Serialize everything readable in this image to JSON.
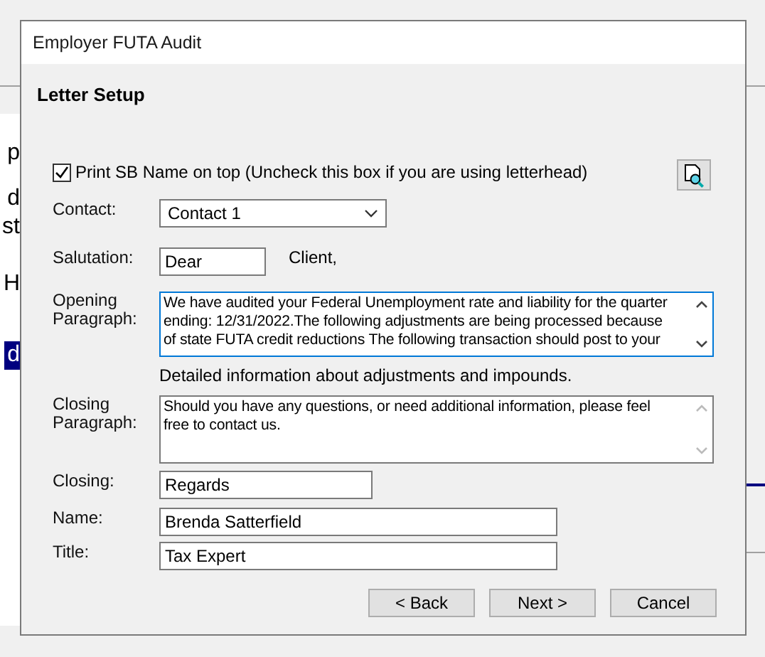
{
  "background": {
    "fragments": [
      {
        "text": "p",
        "selected": false
      },
      {
        "text": "d",
        "selected": false
      },
      {
        "text": "st",
        "selected": false
      },
      {
        "text": "H",
        "selected": false
      },
      {
        "text": "d",
        "selected": true
      }
    ]
  },
  "window": {
    "title": "Employer FUTA Audit"
  },
  "heading": "Letter Setup",
  "print_name": {
    "label": "Print SB Name on top (Uncheck this box if you are using letterhead)",
    "checked": true
  },
  "contact": {
    "label": "Contact:",
    "value": "Contact 1"
  },
  "salutation": {
    "label": "Salutation:",
    "value": "Dear",
    "suffix": "Client,"
  },
  "opening_paragraph": {
    "label": "Opening Paragraph:",
    "focused": true,
    "lines": [
      "We have audited your Federal Unemployment rate and liability for the quarter",
      "ending: 12/31/2022.The following adjustments are being processed because",
      "of state FUTA credit reductions  The following transaction should post to your"
    ]
  },
  "info_text": "Detailed information about adjustments and impounds.",
  "closing_paragraph": {
    "label": "Closing Paragraph:",
    "focused": false,
    "lines": [
      "Should you have any questions, or need additional information, please feel",
      "free to contact us."
    ]
  },
  "fields": [
    {
      "label": "Closing:",
      "value": "Regards"
    },
    {
      "label": "Name:",
      "value": "Brenda Satterfield"
    },
    {
      "label": "Title:",
      "value": "Tax Expert"
    }
  ],
  "buttons": [
    "< Back",
    "Next >",
    "Cancel"
  ]
}
